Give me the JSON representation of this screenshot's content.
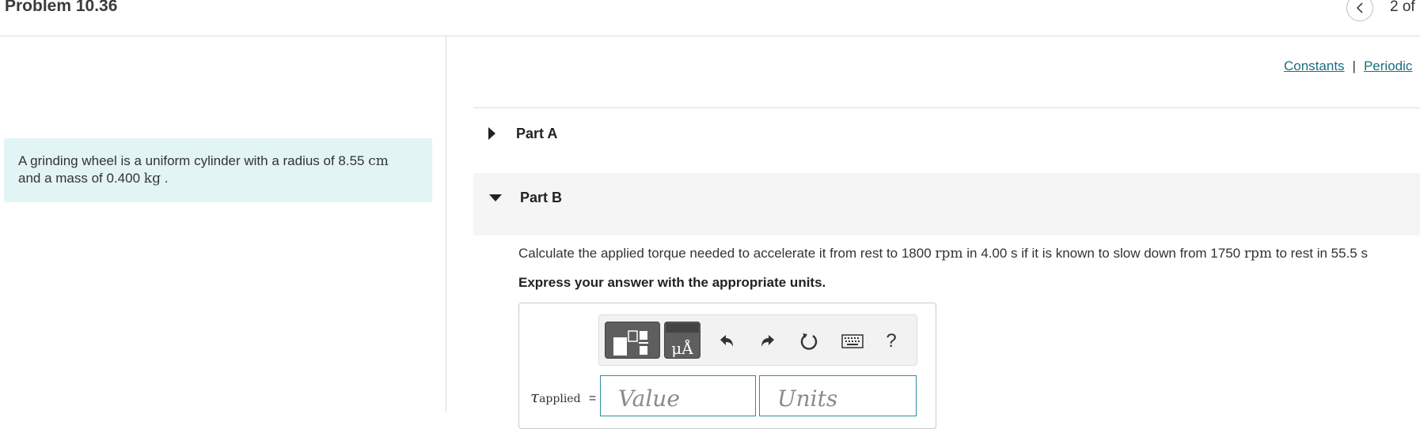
{
  "header": {
    "problem_title": "Problem 10.36",
    "page_count": "2 of"
  },
  "problem": {
    "text_1": "A grinding wheel is a uniform cylinder with a radius of 8.55",
    "unit_1": "cm",
    "text_2": "and a mass of 0.400",
    "unit_2": "kg",
    "text_3": "."
  },
  "links": {
    "constants": "Constants",
    "separator": "|",
    "periodic": "Periodic"
  },
  "parts": {
    "part_a_label": "Part A",
    "part_b_label": "Part B"
  },
  "question": {
    "t1": "Calculate the applied torque needed to accelerate it from rest to 1800",
    "u1": "rpm",
    "t2": "in 4.00 s if it is known to slow down from 1750",
    "u2": "rpm",
    "t3": "to rest in 55.5 s"
  },
  "instruction": "Express your answer with the appropriate units.",
  "answer": {
    "variable": "τ",
    "subscript": "applied",
    "equals": "=",
    "value_placeholder": "Value",
    "units_placeholder": "Units"
  },
  "toolbar": {
    "units_button_text": "μÅ",
    "help_text": "?",
    "icons": [
      "templates-icon",
      "units-icon",
      "undo-icon",
      "redo-icon",
      "reset-icon",
      "keyboard-icon",
      "help-icon"
    ]
  },
  "colors": {
    "accent": "#2f8f9d",
    "link": "#1a6f7f",
    "problem_bg": "#e3f4f4",
    "toolbar_button": "#5e5e5e"
  }
}
